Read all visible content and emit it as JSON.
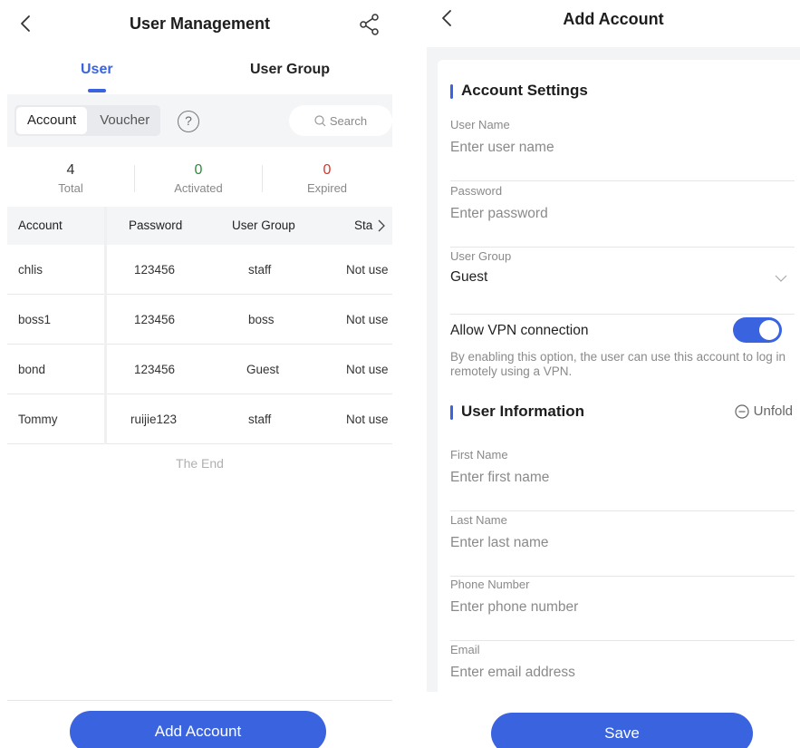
{
  "left": {
    "title": "User Management",
    "tabs": [
      {
        "label": "User"
      },
      {
        "label": "User Group"
      }
    ],
    "segments": [
      "Account",
      "Voucher"
    ],
    "help": "?",
    "search_placeholder": "Search",
    "stats": [
      {
        "value": "4",
        "label": "Total",
        "color": "#333333"
      },
      {
        "value": "0",
        "label": "Activated",
        "color": "#2e8b3e"
      },
      {
        "value": "0",
        "label": "Expired",
        "color": "#d9362b"
      }
    ],
    "table": {
      "headers": [
        "Account",
        "Password",
        "User Group",
        "Sta"
      ],
      "rows": [
        {
          "account": "chlis",
          "password": "123456",
          "group": "staff",
          "status": "Not use"
        },
        {
          "account": "boss1",
          "password": "123456",
          "group": "boss",
          "status": "Not use"
        },
        {
          "account": "bond",
          "password": "123456",
          "group": "Guest",
          "status": "Not use"
        },
        {
          "account": "Tommy",
          "password": "ruijie123",
          "group": "staff",
          "status": "Not use"
        }
      ]
    },
    "end_text": "The End",
    "add_button": "Add Account"
  },
  "right": {
    "title": "Add Account",
    "account_settings": {
      "title": "Account Settings",
      "user_name": {
        "label": "User Name",
        "placeholder": "Enter user name"
      },
      "password": {
        "label": "Password",
        "placeholder": "Enter password"
      },
      "user_group": {
        "label": "User Group",
        "value": "Guest"
      },
      "vpn": {
        "label": "Allow VPN connection",
        "enabled": true,
        "hint": "By enabling this option, the user can use this account to log in remotely using a VPN."
      }
    },
    "user_information": {
      "title": "User Information",
      "unfold": "Unfold",
      "first_name": {
        "label": "First Name",
        "placeholder": "Enter first name"
      },
      "last_name": {
        "label": "Last Name",
        "placeholder": "Enter last name"
      },
      "phone": {
        "label": "Phone Number",
        "placeholder": "Enter phone number"
      },
      "email": {
        "label": "Email",
        "placeholder": "Enter email address"
      }
    },
    "save_button": "Save"
  },
  "colors": {
    "accent": "#3a63e0",
    "activated": "#2e8b3e",
    "expired": "#d9362b"
  },
  "icons": [
    "back-icon",
    "share-icon",
    "search-icon",
    "chevron-right-icon",
    "chevron-down-icon",
    "minus-circle-icon"
  ]
}
